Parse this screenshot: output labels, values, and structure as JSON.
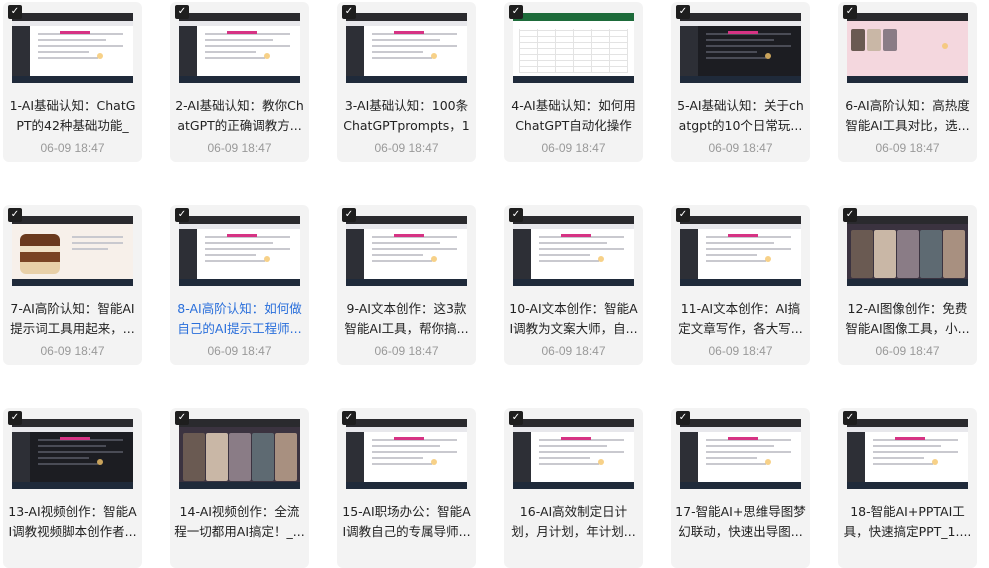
{
  "items": [
    {
      "title": "1-AI基础认知：ChatGPT的42种基础功能_1....",
      "date": "06-09 18:47",
      "thumb": "light"
    },
    {
      "title": "2-AI基础认知：教你ChatGPT的正确调教方...",
      "date": "06-09 18:47",
      "thumb": "light"
    },
    {
      "title": "3-AI基础认知：100条ChatGPTprompts，10...",
      "date": "06-09 18:47",
      "thumb": "light"
    },
    {
      "title": "4-AI基础认知：如何用ChatGPT自动化操作E...",
      "date": "06-09 18:47",
      "thumb": "excel"
    },
    {
      "title": "5-AI基础认知：关于chatgpt的10个日常玩...",
      "date": "06-09 18:47",
      "thumb": "dark"
    },
    {
      "title": "6-AI高阶认知：高热度智能AI工具对比，选...",
      "date": "06-09 18:47",
      "thumb": "portrait"
    },
    {
      "title": "7-AI高阶认知：智能AI提示词工具用起来，...",
      "date": "06-09 18:47",
      "thumb": "cake"
    },
    {
      "title": "8-AI高阶认知：如何做自己的AI提示工程师...",
      "date": "06-09 18:47",
      "thumb": "light",
      "active": true
    },
    {
      "title": "9-AI文本创作：这3款智能AI工具，帮你搞...",
      "date": "06-09 18:47",
      "thumb": "light"
    },
    {
      "title": "10-AI文本创作：智能AI调教为文案大师，自...",
      "date": "06-09 18:47",
      "thumb": "light"
    },
    {
      "title": "11-AI文本创作：AI搞定文章写作，各大写...",
      "date": "06-09 18:47",
      "thumb": "light"
    },
    {
      "title": "12-AI图像创作：免费智能AI图像工具，小...",
      "date": "06-09 18:47",
      "thumb": "img"
    },
    {
      "title": "13-AI视频创作：智能AI调教视频脚本创作者...",
      "date": "",
      "thumb": "dark"
    },
    {
      "title": "14-AI视频创作：全流程一切都用AI搞定！_...",
      "date": "",
      "thumb": "img"
    },
    {
      "title": "15-AI职场办公：智能AI调教自己的专属导师...",
      "date": "",
      "thumb": "light"
    },
    {
      "title": "16-AI高效制定日计划，月计划，年计划...",
      "date": "",
      "thumb": "light"
    },
    {
      "title": "17-智能AI+思维导图梦幻联动，快速出导图...",
      "date": "",
      "thumb": "light"
    },
    {
      "title": "18-智能AI+PPTAI工具，快速搞定PPT_1....",
      "date": "",
      "thumb": "light"
    }
  ],
  "check_glyph": "✓"
}
